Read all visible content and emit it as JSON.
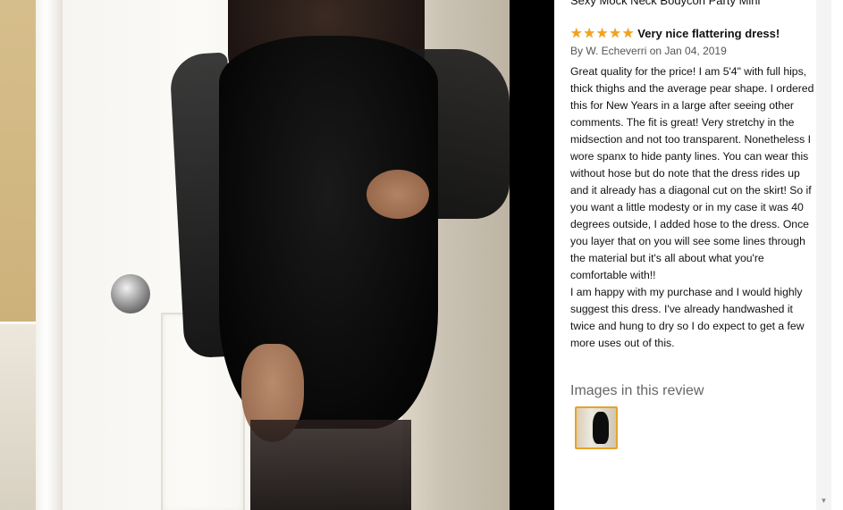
{
  "photo": {
    "alt_semantic": "customer-photo"
  },
  "review": {
    "product_title": "Sexy Mock Neck Bodycon Party Mini",
    "rating_stars": 5,
    "title": "Very nice flattering dress!",
    "byline": "By W. Echeverri on Jan 04, 2019",
    "body": "Great quality for the price! I am 5'4\" with full hips, thick thighs and the average pear shape. I ordered this for New Years in a large after seeing other comments. The fit is great! Very stretchy in the midsection and not too transparent. Nonetheless I wore spanx to hide panty lines. You can wear this without hose but do note that the dress rides up and it already has a diagonal cut on the skirt! So if you want a little modesty or in my case it was 40 degrees outside, I added hose to the dress. Once you layer that on you will see some lines through the material but it's all about what you're comfortable with!!\nI am happy with my purchase and I would highly suggest this dress. I've already handwashed it twice and hung to dry so I do expect to get a few more uses out of this.",
    "images_heading": "Images in this review"
  },
  "colors": {
    "star": "#f4a21a",
    "thumb_border": "#e7a32a"
  },
  "icons": {
    "star": "star-icon",
    "scroll_down": "scroll-down-arrow-icon"
  }
}
